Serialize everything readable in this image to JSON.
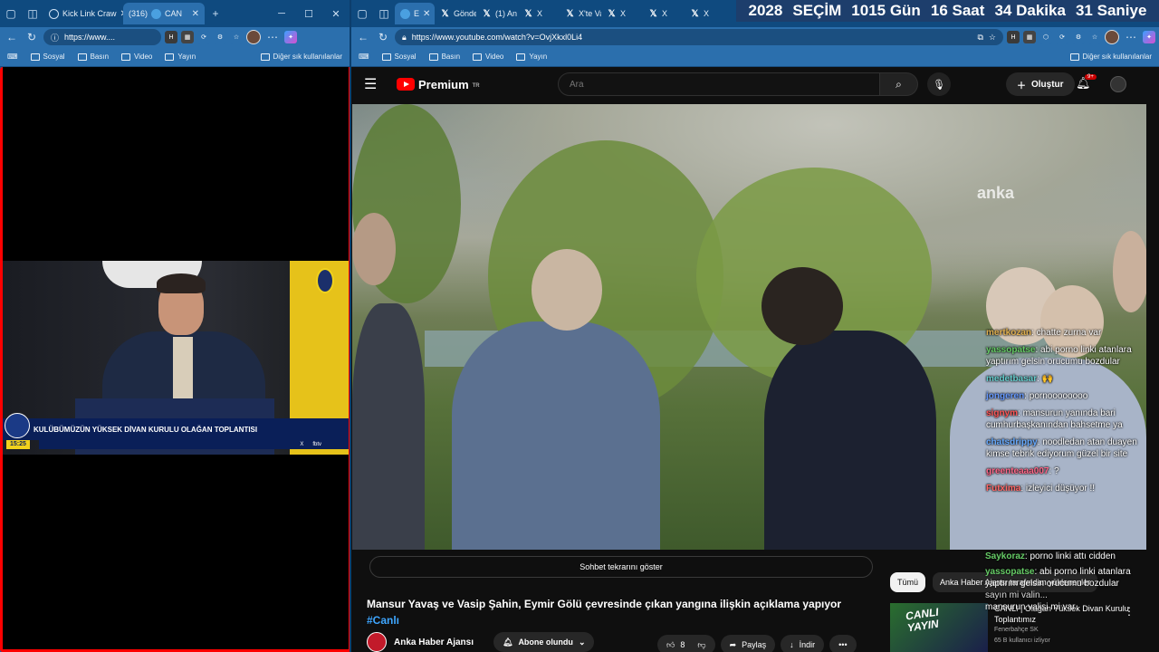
{
  "left_window": {
    "tabs": [
      {
        "label": "Kick Link Craw",
        "icon": "globe-icon"
      },
      {
        "label": "(316)",
        "icon": "youtube-icon",
        "extra": "CAN"
      }
    ],
    "new_tab": "+",
    "url": "https://www....",
    "bookmarks": [
      "Sosyal",
      "Basın",
      "Video",
      "Yayın"
    ],
    "other_bookmarks": "Diğer sık kullanılanlar",
    "video": {
      "lower_third": "KULÜBÜMÜZÜN YÜKSEK DİVAN KURULU OLAĞAN TOPLANTISI",
      "time": "15:25",
      "ticker_x": "X",
      "ticker_brand": "fbtv"
    }
  },
  "right_window": {
    "tabs": [
      {
        "label": "E",
        "icon": "edge-icon"
      },
      {
        "label": "Gönde",
        "icon": "x-icon"
      },
      {
        "label": "(1) An",
        "icon": "x-icon"
      },
      {
        "label": "X",
        "icon": "x-icon"
      },
      {
        "label": "X'te Va",
        "icon": "x-icon"
      },
      {
        "label": "X",
        "icon": "x-icon"
      },
      {
        "label": "X",
        "icon": "x-icon"
      },
      {
        "label": "X",
        "icon": "x-icon"
      }
    ],
    "countdown": {
      "year": "2028",
      "label": "SEÇİM",
      "days": "1015 Gün",
      "hours": "16 Saat",
      "minutes": "34 Dakika",
      "seconds": "31 Saniye"
    },
    "url": "https://www.youtube.com/watch?v=OvjXkxl0Li4",
    "bookmarks": [
      "Sosyal",
      "Basın",
      "Video",
      "Yayın"
    ],
    "other_bookmarks": "Diğer sık kullanılanlar"
  },
  "youtube": {
    "logo": "Premium",
    "logo_suffix": "TR",
    "search_placeholder": "Ara",
    "create_label": "Oluştur",
    "notif_count": "9+",
    "watermark": "anka",
    "chat_replay": "Sohbet tekrarını göster",
    "title": "Mansur Yavaş ve Vasip Şahin, Eymir Gölü çevresinde çıkan yangına ilişkin açıklama yapıyor",
    "hashtag": "#Canlı",
    "channel": "Anka Haber Ajansı",
    "subscribe": "Abone olundu",
    "likes": "8",
    "share": "Paylaş",
    "download": "İndir",
    "more": "•••",
    "chips": [
      "Tümü",
      "Anka Haber Ajansı tarafından yüklenenler"
    ],
    "recommended": {
      "thumb_text_1": "CANLI",
      "thumb_text_2": "YAYIN",
      "title": "CANLI | Olağan Yüksek Divan Kurulu Toplantımız",
      "channel": "Fenerbahçe SK",
      "viewers": "65 B kullanıcı izliyor"
    },
    "chat_overlay": [
      {
        "user": "mertkozan",
        "text": "chatte zurna var",
        "color": "#e0b050"
      },
      {
        "user": "yassopatse",
        "text": "abi porno linki atanlara yaptırım gelsin orucumu bozdular",
        "color": "#66cc66"
      },
      {
        "user": "medetbasar",
        "text": "🙌",
        "color": "#66cccc"
      },
      {
        "user": "jongeren",
        "text": "pornoooooooo",
        "color": "#6699ff"
      },
      {
        "user": "signym",
        "text": "mansurun yanında bari cumhurbaşkanından bahsetme ya",
        "color": "#ff5555"
      },
      {
        "user": "chatsdrippy",
        "text": "noodledan atan duayen kimse tebrik ediyorum güzel bir site",
        "color": "#66aaff"
      },
      {
        "user": "greenteaaa007",
        "text": "?",
        "color": "#ff6688"
      },
      {
        "user": "Futxima",
        "text": "izleyici düşüyor !!",
        "color": "#ff6666"
      }
    ],
    "chat_below": [
      {
        "user": "Saykoraz",
        "text": "porno linki attı cidden",
        "color": "#66cc66"
      },
      {
        "user": "yassopatse",
        "text": "abi porno linki atanlara yaptırım gelsin orucumu bozdular",
        "color": "#66cc66"
      },
      {
        "user": "",
        "text": "sayın mi valin...",
        "color": "#ffffff"
      },
      {
        "user": "",
        "text": "mansurun valisi mi var",
        "color": "#ffffff"
      }
    ]
  }
}
